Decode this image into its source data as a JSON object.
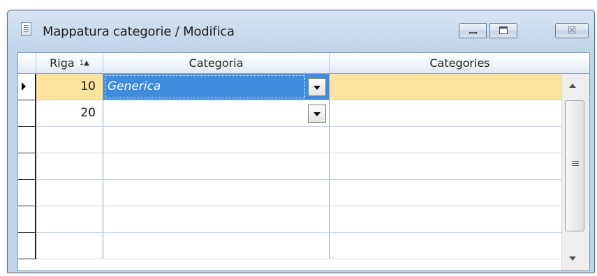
{
  "window": {
    "title": "Mappatura categorie / Modifica",
    "close_glyph": "☒"
  },
  "grid": {
    "columns": [
      {
        "label": "Riga",
        "sort_indicator": "1"
      },
      {
        "label": "Categoria"
      },
      {
        "label": "Categories"
      }
    ],
    "rows": [
      {
        "riga": "10",
        "categoria": "Generica",
        "categories": ""
      },
      {
        "riga": "20",
        "categoria": "",
        "categories": ""
      },
      {
        "riga": "",
        "categoria": "",
        "categories": ""
      },
      {
        "riga": "",
        "categoria": "",
        "categories": ""
      },
      {
        "riga": "",
        "categoria": "",
        "categories": ""
      },
      {
        "riga": "",
        "categoria": "",
        "categories": ""
      },
      {
        "riga": "",
        "categoria": "",
        "categories": ""
      }
    ],
    "current_row": 1
  },
  "colors": {
    "current_row_bg": "#fde49c",
    "selected_cell_bg": "#3f8bdc",
    "header_border": "#92a5bd"
  },
  "icons": {
    "window": "form-icon",
    "minimize": "minimize-icon",
    "maximize": "maximize-icon",
    "close": "close-icon",
    "dropdown": "chevron-down-icon",
    "row_pointer": "triangle-right-icon"
  }
}
